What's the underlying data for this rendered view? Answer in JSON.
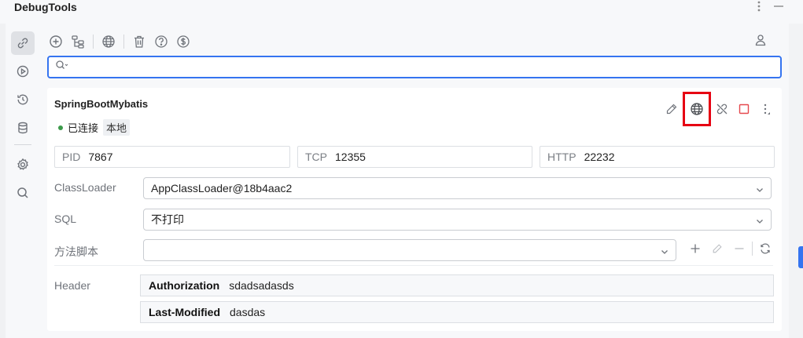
{
  "window": {
    "title": "DebugTools"
  },
  "toolbar": {
    "icons": [
      "add-circle-icon",
      "tree-icon",
      "globe-icon",
      "trash-icon",
      "help-icon",
      "dollar-icon"
    ],
    "user_icon": "user-icon"
  },
  "search": {
    "value": "",
    "placeholder": ""
  },
  "connection": {
    "name": "SpringBootMybatis",
    "status": "已连接",
    "location": "本地",
    "status_color": "#3c9a4a",
    "pid_label": "PID",
    "pid": "7867",
    "tcp_label": "TCP",
    "tcp": "12355",
    "http_label": "HTTP",
    "http": "22232"
  },
  "form": {
    "classloader_label": "ClassLoader",
    "classloader_value": "AppClassLoader@18b4aac2",
    "sql_label": "SQL",
    "sql_value": "不打印",
    "script_label": "方法脚本",
    "script_value": "",
    "header_label": "Header",
    "headers": [
      {
        "key": "Authorization",
        "value": "sdadsadasds"
      },
      {
        "key": "Last-Modified",
        "value": "dasdas"
      }
    ]
  },
  "colors": {
    "accent": "#3574f0",
    "highlight": "#e60012",
    "stop": "#e5484d"
  }
}
